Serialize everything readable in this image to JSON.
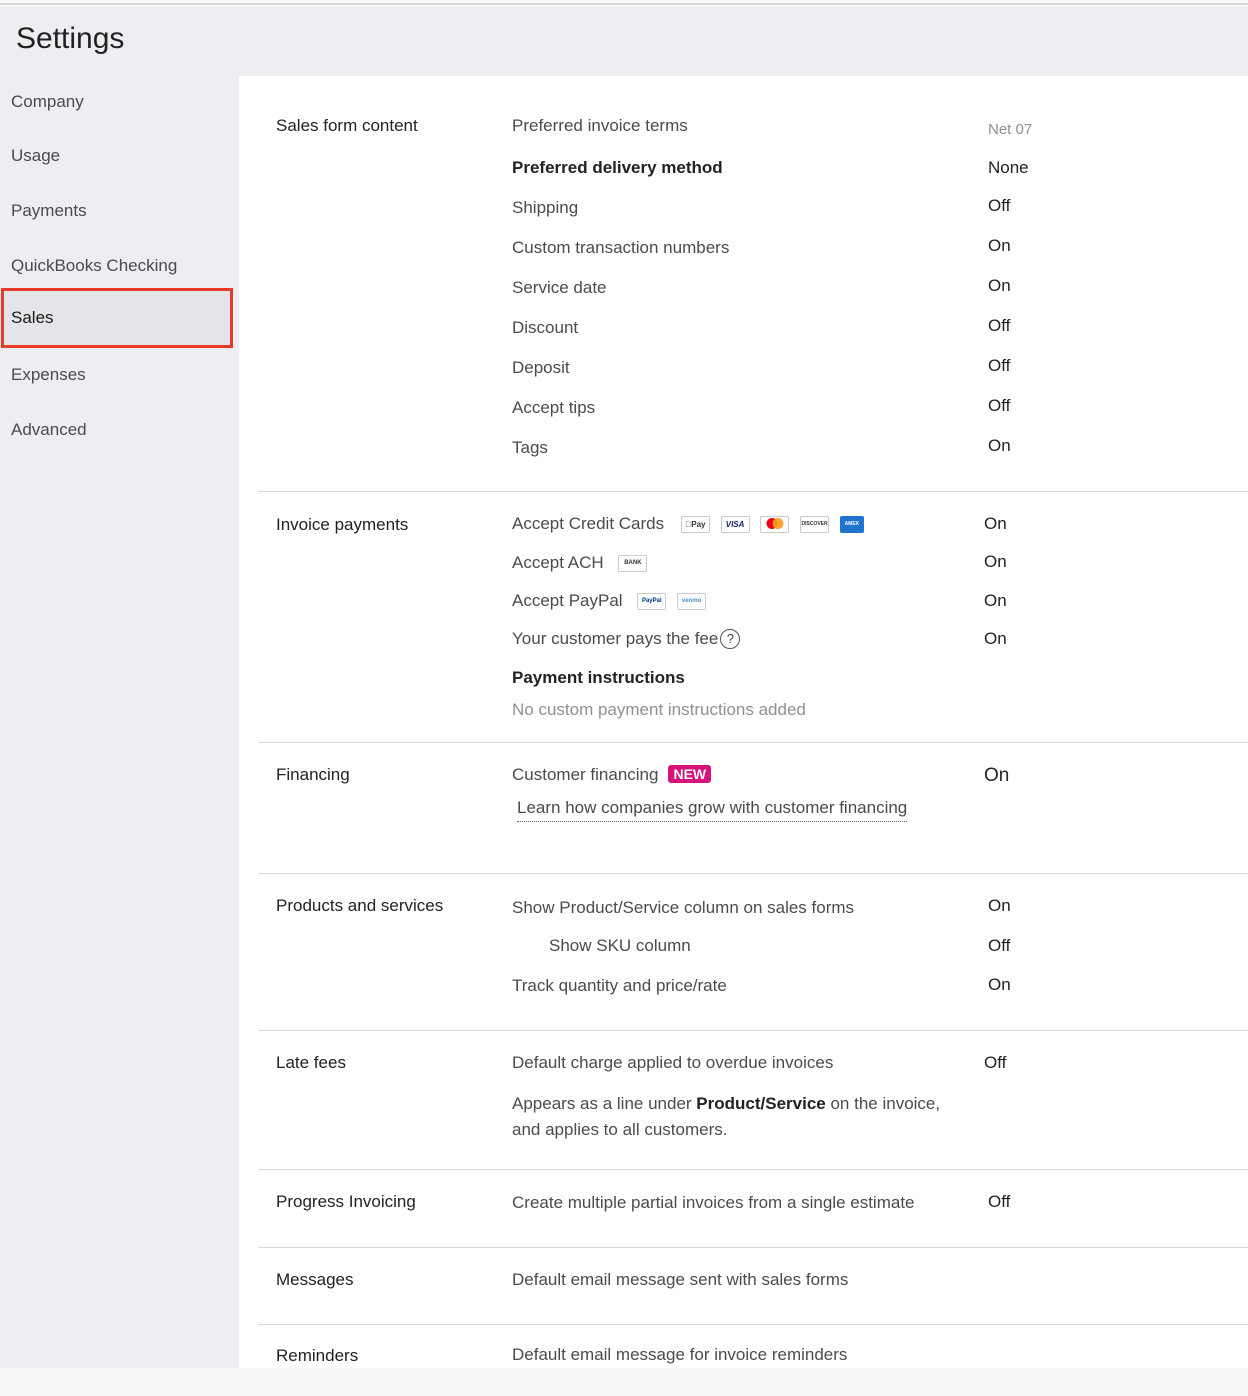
{
  "header": {
    "title": "Settings"
  },
  "sidebar": {
    "items": [
      {
        "label": "Company"
      },
      {
        "label": "Usage"
      },
      {
        "label": "Payments"
      },
      {
        "label": "QuickBooks Checking"
      },
      {
        "label": "Sales",
        "active": true
      },
      {
        "label": "Expenses"
      },
      {
        "label": "Advanced"
      }
    ]
  },
  "sections": {
    "sales_form": {
      "title": "Sales form content",
      "rows": [
        {
          "label": "Preferred invoice terms",
          "value": "Net 07"
        },
        {
          "label": "Preferred delivery method",
          "value": "None"
        },
        {
          "label": "Shipping",
          "value": "Off"
        },
        {
          "label": "Custom transaction numbers",
          "value": "On"
        },
        {
          "label": "Service date",
          "value": "On"
        },
        {
          "label": "Discount",
          "value": "Off"
        },
        {
          "label": "Deposit",
          "value": "Off"
        },
        {
          "label": "Accept tips",
          "value": "Off"
        },
        {
          "label": "Tags",
          "value": "On"
        }
      ]
    },
    "invoice_payments": {
      "title": "Invoice payments",
      "rows": [
        {
          "label": "Accept Credit Cards",
          "value": "On"
        },
        {
          "label": "Accept ACH",
          "value": "On"
        },
        {
          "label": "Accept PayPal",
          "value": "On"
        },
        {
          "label": "Your customer pays the fee",
          "value": "On"
        }
      ],
      "cards": {
        "apple_pay": "Pay",
        "visa": "VISA",
        "discover": "DISCOVER",
        "amex": "AMEX",
        "bank": "BANK",
        "paypal": "PayPal",
        "venmo": "venmo"
      },
      "help": "?",
      "payment_instructions_title": "Payment instructions",
      "payment_instructions_text": "No custom payment instructions added"
    },
    "financing": {
      "title": "Financing",
      "label": "Customer financing",
      "badge": "NEW",
      "value": "On",
      "link": "Learn how companies grow with customer financing"
    },
    "products": {
      "title": "Products and services",
      "rows": [
        {
          "label": "Show Product/Service column on sales forms",
          "value": "On"
        },
        {
          "label": "Show SKU column",
          "value": "Off"
        },
        {
          "label": "Track quantity and price/rate",
          "value": "On"
        }
      ]
    },
    "late_fees": {
      "title": "Late fees",
      "label": "Default charge applied to overdue invoices",
      "value": "Off",
      "desc_prefix": "Appears as a line under ",
      "desc_bold": "Product/Service",
      "desc_suffix": " on the invoice,",
      "desc_line2": "and applies to all customers."
    },
    "progress": {
      "title": "Progress Invoicing",
      "label": "Create multiple partial invoices from a single estimate",
      "value": "Off"
    },
    "messages": {
      "title": "Messages",
      "label": "Default email message sent with sales forms"
    },
    "reminders": {
      "title": "Reminders",
      "label": "Default email message for invoice reminders"
    }
  },
  "colors": {
    "accent_red": "#e8392b",
    "new_badge": "#d4147a",
    "sidebar_bg": "#eceef1"
  }
}
